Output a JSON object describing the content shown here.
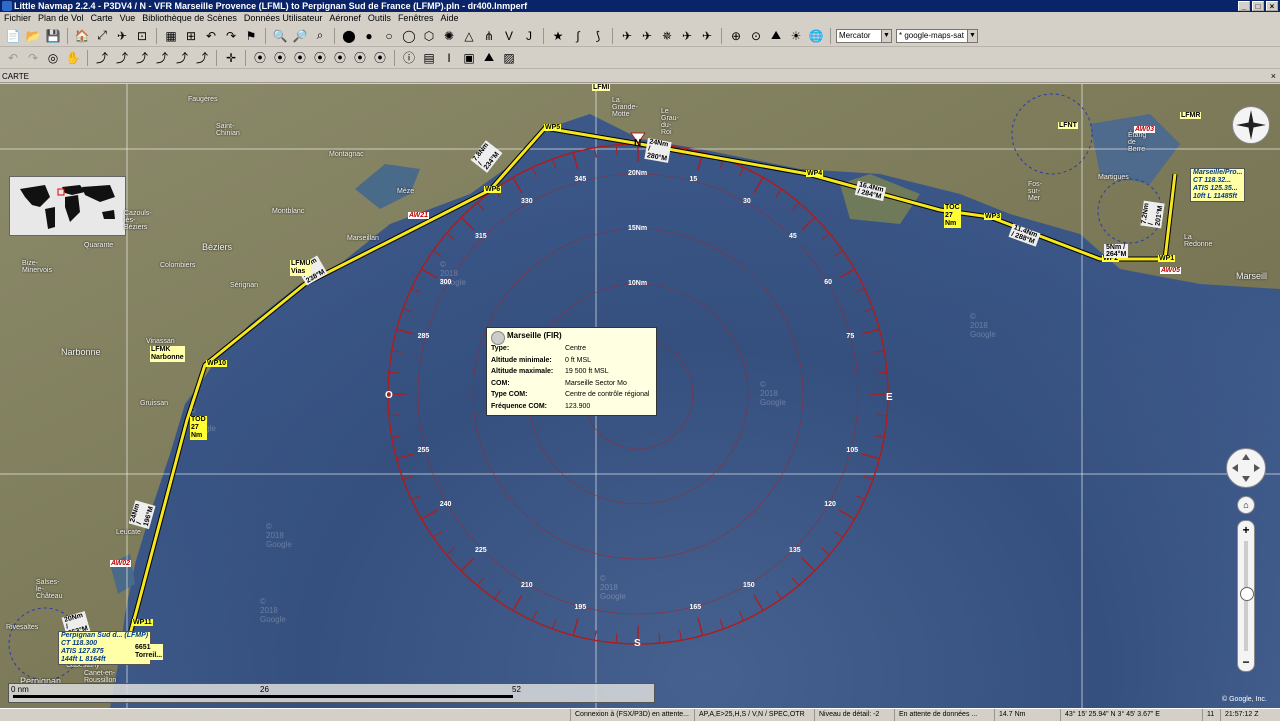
{
  "window": {
    "title": "Little Navmap 2.2.4 - P3DV4 / N - VFR Marseille Provence (LFML) to Perpignan Sud de France (LFMP).pln - dr400.lnmperf"
  },
  "menu": [
    "Fichier",
    "Plan de Vol",
    "Carte",
    "Vue",
    "Bibliothèque de Scènes",
    "Données Utilisateur",
    "Aéronef",
    "Outils",
    "Fenêtres",
    "Aide"
  ],
  "toolbar": {
    "projection": "Mercator",
    "theme": "* google-maps-sat"
  },
  "panel": {
    "title": "CARTE"
  },
  "map": {
    "places": {
      "faugeres": "Faugères",
      "saint_chinian": "Saint-Chinian",
      "montblanc": "Montblanc",
      "cazouls": "Cazouls-lès-Béziers",
      "beziers": "Béziers",
      "colombiers": "Colombiers",
      "quarante": "Quarante",
      "bize": "Bize-Minervois",
      "serignan": "Sérignan",
      "marseillan": "Marseillan",
      "meze": "Mèze",
      "montagnac": "Montagnac",
      "narbonne": "Narbonne",
      "gruissan": "Gruissan",
      "vinassan": "Vinassan",
      "leucate": "Leucate",
      "salses": "Salses-le-Château",
      "rivesaltes": "Rivesaltes",
      "perpignan": "Perpignan",
      "cabestany": "Cabestany",
      "canet": "Canet-en-Roussillon",
      "grau": "Le Grau-du-Roi",
      "grande_motte": "La Grande-Motte",
      "martigues": "Martigues",
      "fos": "Fos-sur-Mer",
      "marseille_city": "Marseill",
      "redonne": "La Redonne",
      "etang": "Étang de Berre"
    },
    "waypoints": {
      "wp1": "WP1",
      "wp2": "WP2",
      "wp3": "WP3",
      "wp4": "WP4",
      "wp5": "WP5",
      "wp6": "WP6",
      "wp10": "WP10",
      "wp11": "WP11",
      "toc": "TOC",
      "tod": "TOD",
      "toc_dist": "27 Nm",
      "tod_dist": "27 Nm"
    },
    "legs": {
      "leg1": "7.2Nm / 201°M",
      "leg2": "5Nm / 264°M",
      "leg3": "11.4Nm / 288°M",
      "leg4": "16.4Nm / 284°M",
      "leg5": "24Nm / 280°M",
      "leg6": "7.8Nm / 234°M",
      "leg7": "29Nm / 238°M",
      "leg8": "24Nm / 196°M",
      "leg9": "20Nm / 253°M"
    },
    "airports": {
      "lfml_name": "Marseille/Pro...",
      "lfml_ct": "CT 118.32...",
      "lfml_atis": "ATIS 125.35...",
      "lfml_elev": "10ft L 11485ft",
      "lfmp_name": "Perpignan Sud d... (LFMP)",
      "lfmp_ct": "CT 118.300",
      "lfmp_atis": "ATIS 127.875",
      "lfmp_elev": "144ft L 8164ft",
      "lfmu": "LFMU",
      "lfmu_sub": "Vias",
      "lfmk": "LFMK",
      "lfmk_sub": "Narbonne",
      "lfmi": "LFMI",
      "lfmr": "LFMR",
      "lfnt": "LFNT",
      "vor_6651": "6651",
      "vor_6651_sub": "Torreil..."
    },
    "airspaces": {
      "aw01": "AW01",
      "aw02": "AW02",
      "aw03": "AW03",
      "aw05": "AW05",
      "aw21": "AW21"
    },
    "compass": {
      "north": "N",
      "east": "E",
      "south": "S",
      "west": "O",
      "ticks": [
        "15",
        "30",
        "45",
        "60",
        "75",
        "105",
        "120",
        "135",
        "150",
        "165",
        "195",
        "210",
        "225",
        "240",
        "255",
        "285",
        "300",
        "315",
        "330",
        "345"
      ],
      "rings": [
        "20Nm",
        "15Nm",
        "10Nm"
      ]
    },
    "watermark": "© 2018 Google",
    "copyright": "© Google, Inc."
  },
  "tooltip": {
    "title": "Marseille (FIR)",
    "rows": [
      {
        "k": "Type:",
        "v": "Centre"
      },
      {
        "k": "Altitude minimale:",
        "v": "0 ft MSL"
      },
      {
        "k": "Altitude maximale:",
        "v": "19 500 ft MSL"
      },
      {
        "k": "COM:",
        "v": "Marseille Sector Mo"
      },
      {
        "k": "Type COM:",
        "v": "Centre de contrôle régional"
      },
      {
        "k": "Fréquence COM:",
        "v": "123.900"
      }
    ]
  },
  "scale": {
    "t0": "0 nm",
    "t1": "26",
    "t2": "52"
  },
  "status": {
    "connection": "Connexion à (FSX/P3D) en attente...",
    "filters": "AP,A,E>25,H,S / V,N / SPEC,OTR",
    "detail": "Niveau de détail: -2",
    "data": "En attente de données ...",
    "range": "14.7 Nm",
    "coords": "43° 15' 25.94\" N 3° 45' 3.67\" E",
    "zone": "11",
    "time": "21:57:12 Z"
  }
}
